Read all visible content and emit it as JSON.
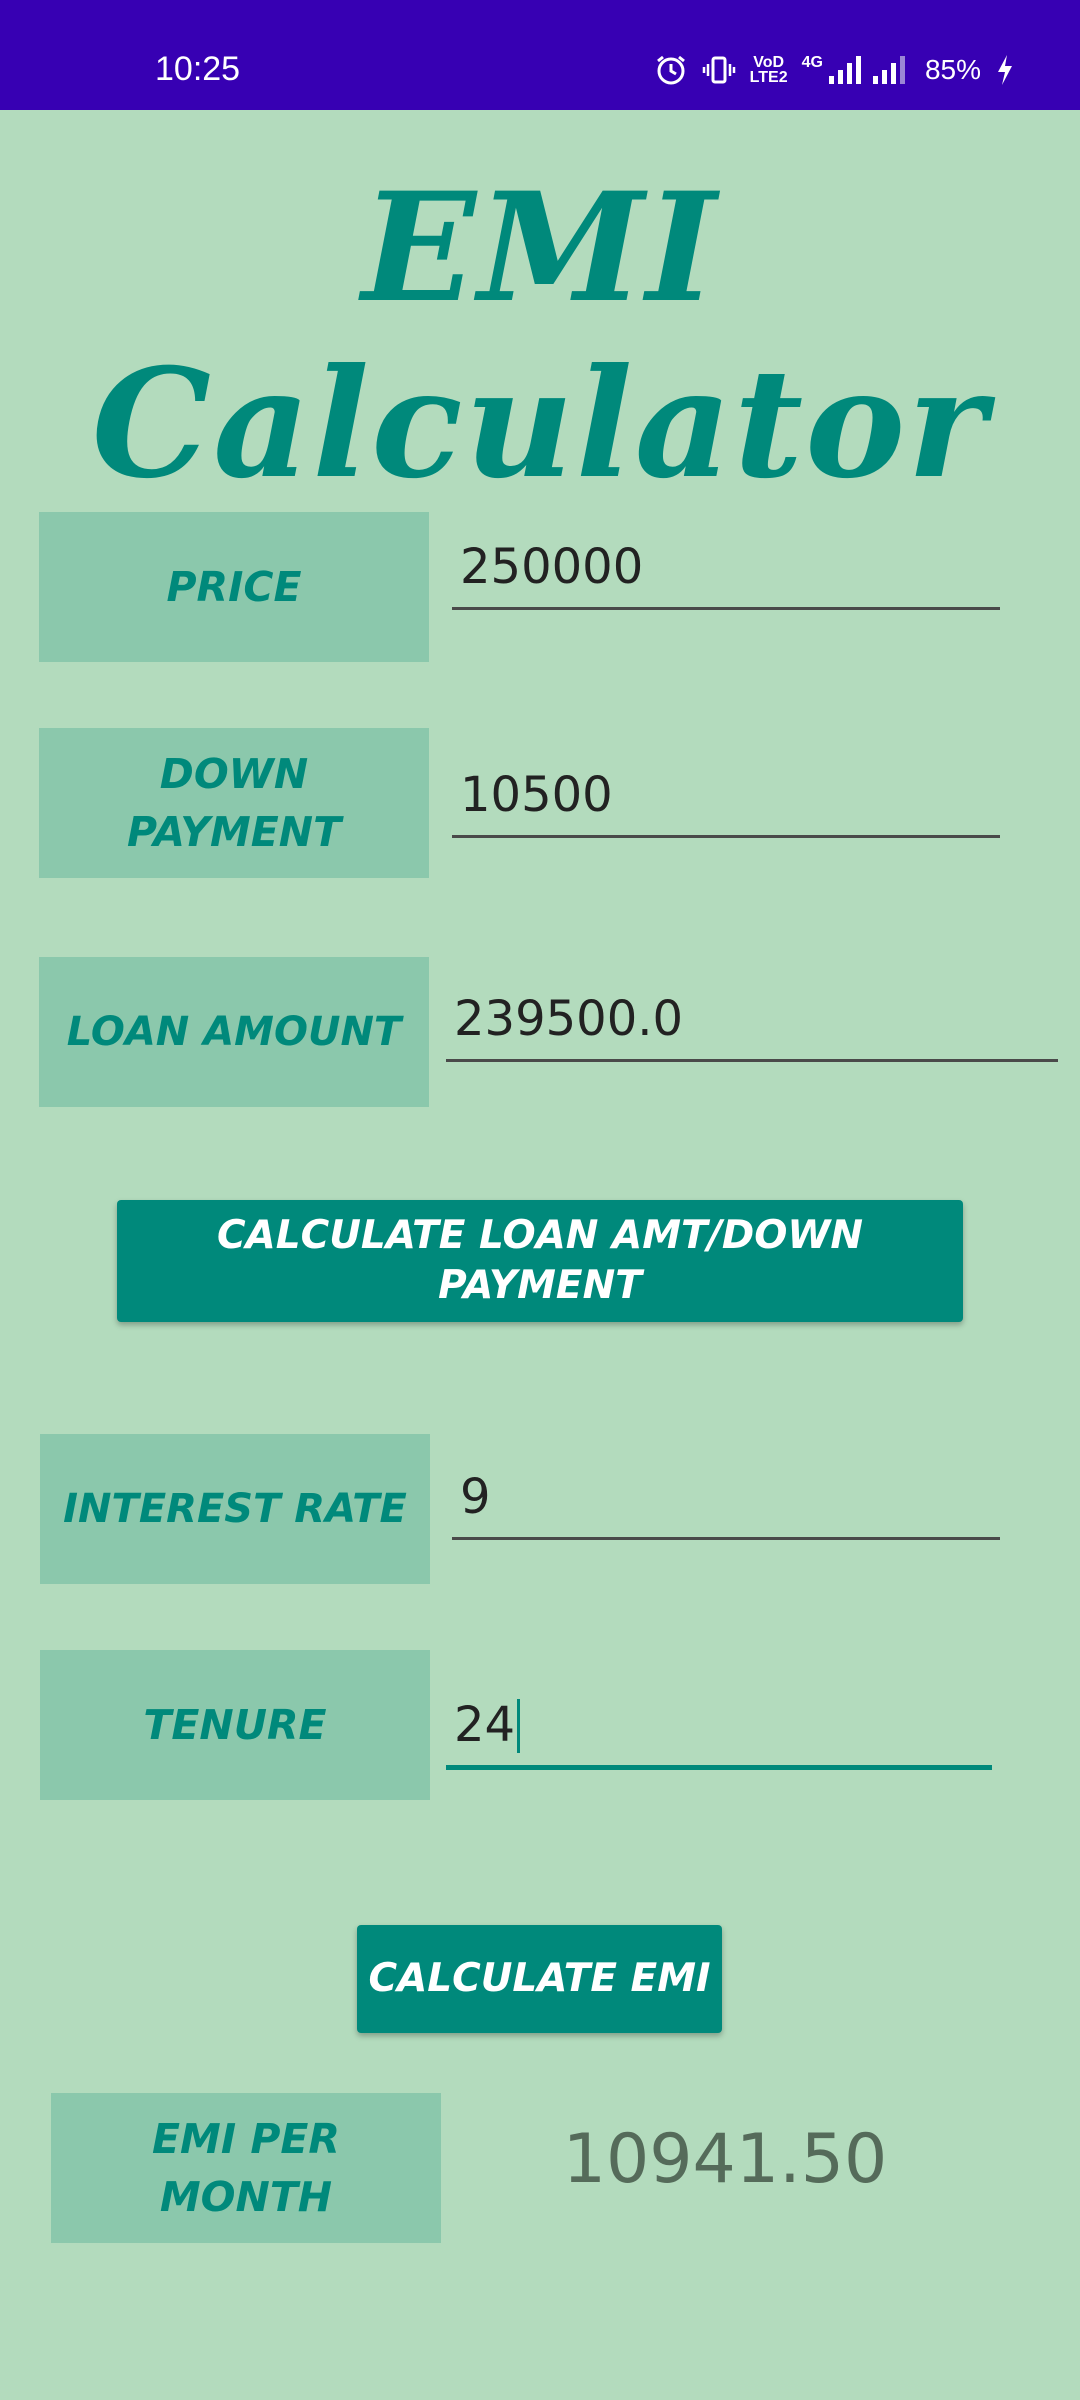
{
  "status_bar": {
    "time": "10:25",
    "network_label_top": "VoD",
    "network_label_bottom": "LTE2",
    "network_type": "4G",
    "battery": "85%"
  },
  "app": {
    "title": "EMI Calculator"
  },
  "form": {
    "price": {
      "label": "PRICE",
      "value": "250000"
    },
    "down_payment": {
      "label": "DOWN PAYMENT",
      "value": "10500"
    },
    "loan_amount": {
      "label": "LOAN AMOUNT",
      "value": "239500.0"
    },
    "calc_loan_button": "CALCULATE LOAN AMT/DOWN PAYMENT",
    "interest_rate": {
      "label": "INTEREST RATE",
      "value": "9"
    },
    "tenure": {
      "label": "TENURE",
      "value": "24"
    },
    "calc_emi_button": "CALCULATE EMI",
    "emi": {
      "label": "EMI PER MONTH",
      "value": "10941.50"
    }
  },
  "colors": {
    "status_bar": "#3700b3",
    "background": "#b3dbbd",
    "label_bg": "#8bc8ac",
    "accent": "#00897b"
  },
  "icons": [
    "alarm-icon",
    "vibrate-icon",
    "signal-icon",
    "charging-icon"
  ]
}
